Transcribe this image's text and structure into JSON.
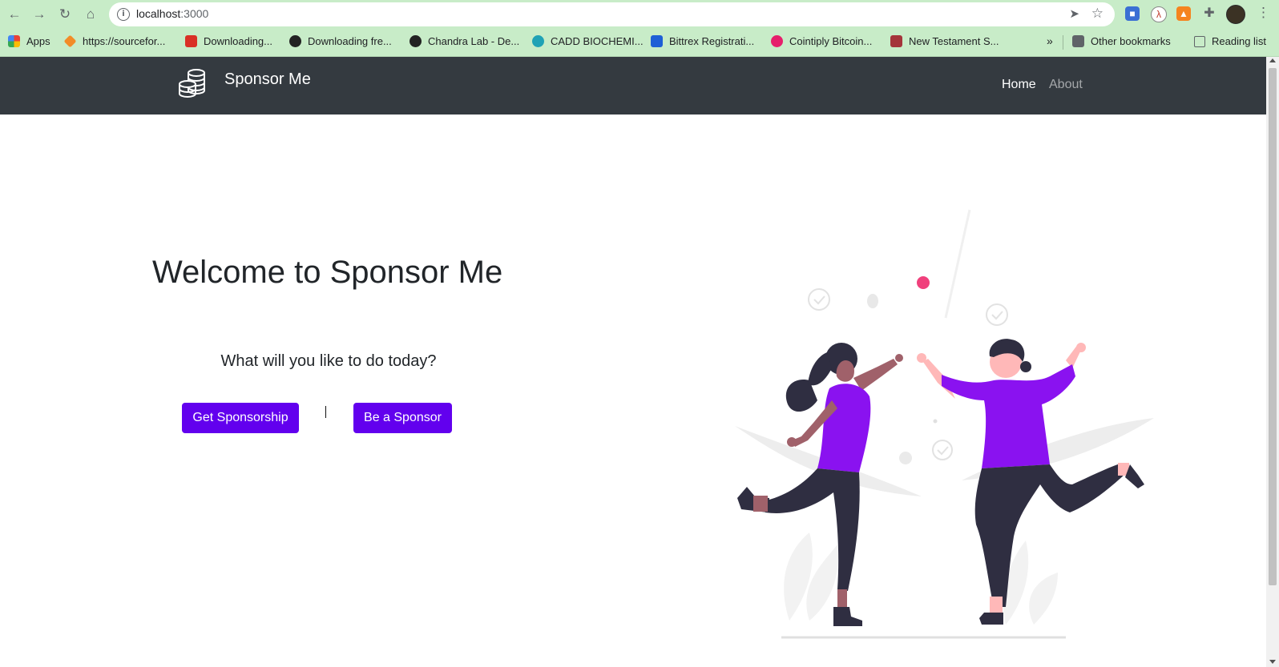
{
  "browser": {
    "url_host": "localhost",
    "url_port": ":3000",
    "bookmarks": [
      {
        "label": "Apps"
      },
      {
        "label": "https://sourcefor..."
      },
      {
        "label": "Downloading..."
      },
      {
        "label": "Downloading fre..."
      },
      {
        "label": "Chandra Lab - De..."
      },
      {
        "label": "CADD BIOCHEMI..."
      },
      {
        "label": "Bittrex Registrati..."
      },
      {
        "label": "Cointiply Bitcoin..."
      },
      {
        "label": "New Testament S..."
      }
    ],
    "more_bookmarks": "»",
    "other_bookmarks": "Other bookmarks",
    "reading_list": "Reading list"
  },
  "navbar": {
    "brand": "Sponsor Me",
    "links": [
      {
        "label": "Home"
      },
      {
        "label": "About"
      }
    ]
  },
  "hero": {
    "title": "Welcome to Sponsor Me",
    "subtitle": "What will you like to do today?",
    "buttons": [
      {
        "label": "Get Sponsorship"
      },
      {
        "label": "Be a Sponsor"
      }
    ]
  },
  "colors": {
    "accent": "#6200ee",
    "navbar": "#343a40",
    "browser_chrome": "#c8ecc8",
    "illustration_shirt": "#8a12f0",
    "illustration_dot": "#f0407c"
  }
}
